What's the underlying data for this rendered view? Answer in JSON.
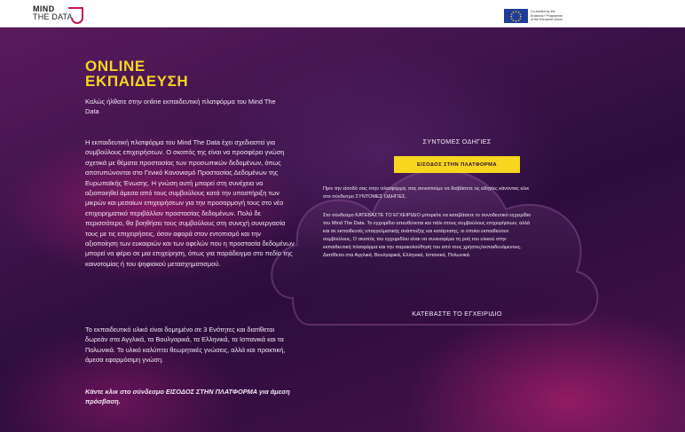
{
  "header": {
    "logo_line1": "MIND",
    "logo_line2": "THE DATA",
    "eu_line1": "Co-funded by the",
    "eu_line2": "Erasmus+ Programme",
    "eu_line3": "of the European Union"
  },
  "hero": {
    "title_line1": "ONLINE",
    "title_line2": "ΕΚΠΑΙΔΕΥΣΗ",
    "lead": "Καλώς ήλθατε στην online εκπαιδευτική πλατφόρμα του Mind The Data",
    "paragraph1": "Η εκπαιδευτική πλατφόρμα του Mind The Data έχει σχεδιαστεί για συμβούλους επιχειρήσεων. Ο σκοπός της είναι να προσφέρει γνώση σχετικά με θέματα προστασίας των προσωπικών δεδομένων, όπως αποτυπώνονται στο Γενικό Κανονισμό Προστασίας Δεδομένων της Ευρωπαϊκής Ένωσης. Η γνώση αυτή μπορεί στη συνέχεια να αξιοποιηθεί άμεσα από τους συμβούλους κατά την υποστήριξη των μικρών και μεσαίων επιχειρήσεων για την προσαρμογή τους στο νέο επιχειρηματικό περιβάλλον προστασίας δεδομένων. Πολύ δε περισσότερο, θα βοηθήσει τους συμβούλους στη συνεχή συνεργασία τους με τις επιχειρήσεις, όσον αφορά στον εντοπισμό και την αξιοποίηση των ευκαιριών και των οφελών που η προστασία δεδομένων μπορεί να φέρει σε μια επιχείρηση, όπως για παράδειγμα στο πεδίο της καινοτομίας ή του ψηφιακού μετασχηματισμού.",
    "paragraph2": "Το εκπαιδευτικό υλικό είναι δομημένο σε 3 Ενότητες και διατίθεται δωρεάν στα Αγγλικά, τα Βουλγαρικά, τα Ελληνικά, τα Ισπανικά και τα Πολωνικά. Το υλικό καλύπτει θεωρητικές γνώσεις, αλλά και πρακτική, άμεσα εφαρμόσιμη γνώση.",
    "cta": "Κάντε κλικ στο σύνδεσμο ΕΙΣΟΔΟΣ ΣΤΗΝ ΠΛΑΤΦΟΡΜΑ για άμεση πρόσβαση."
  },
  "right": {
    "title": "ΣΥΝΤΟΜΕΣ ΟΔΗΓΙΕΣ",
    "button": "ΕΙΣΟΔΟΣ ΣΤΗΝ ΠΛΑΤΦΟΡΜΑ",
    "intro": "Πριν την είσοδό σας στην πλατφόρμα, σας συνιστούμε να διαβάσετε τις οδηγίες κάνοντας κλικ στο σύνδεσμο ΣΥΝΤΟΜΕΣ ΟΔΗΓΙΕΣ.",
    "instructions": "Στο σύνδεσμο ΚΑΤΕΒΑΣΤΕ ΤΟ ΕΓΧΕΙΡΙΔΙΟ μπορείτε να κατεβάσετε το συνοδευτικό εγχειρίδιο του Mind The Data. Το εγχειρίδιο απευθύνεται και πάλι στους συμβούλους επιχειρήσεων, αλλά και σε εκπαιδευτές επαγγελματικής ανάπτυξης και κατάρτισης, οι οποίοι εκπαιδεύουν συμβούλους. Ο σκοπός του εγχειριδίου είναι να συνεισφέρει τη ροή του υλικού στην εκπαιδευτική πλατφόρμα και την παρακολούθησή του από τους χρήστες/εκπαιδευόμενους. Διατίθεται στα Αγγλικά, Βουλγαρικά, Ελληνικά, Ισπανικά, Πολωνικά.",
    "download": "ΚΑΤΕΒΑΣΤΕ ΤΟ ΕΓΧΕΙΡΙΔΙΟ"
  },
  "colors": {
    "accent_yellow": "#f6d61e",
    "brand_magenta": "#c2185b",
    "background_purple": "#2c0d3d"
  }
}
